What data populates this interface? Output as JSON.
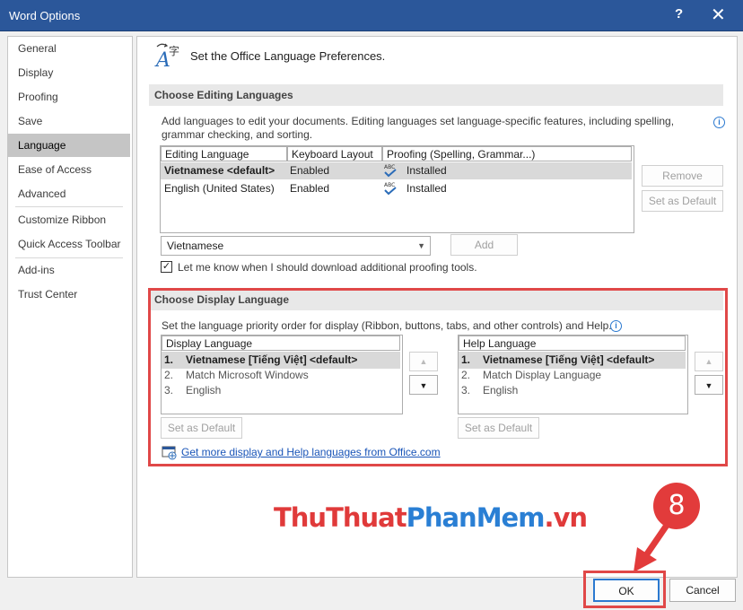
{
  "window": {
    "title": "Word Options",
    "help_glyph": "?",
    "close_glyph": "✕"
  },
  "nav": {
    "items": [
      "General",
      "Display",
      "Proofing",
      "Save",
      "Language",
      "Ease of Access",
      "Advanced",
      "Customize Ribbon",
      "Quick Access Toolbar",
      "Add-ins",
      "Trust Center"
    ],
    "selected": "Language"
  },
  "header": {
    "title": "Set the Office Language Preferences."
  },
  "editing": {
    "section_title": "Choose Editing Languages",
    "description": "Add languages to edit your documents. Editing languages set language-specific features, including spelling, grammar checking, and sorting.",
    "columns": [
      "Editing Language",
      "Keyboard Layout",
      "Proofing (Spelling, Grammar...)"
    ],
    "rows": [
      {
        "language": "Vietnamese <default>",
        "keyboard": "Enabled",
        "proofing": "Installed",
        "selected": true
      },
      {
        "language": "English (United States)",
        "keyboard": "Enabled",
        "proofing": "Installed",
        "selected": false
      }
    ],
    "remove_label": "Remove",
    "set_default_label": "Set as Default",
    "combo_value": "Vietnamese",
    "add_label": "Add",
    "checkbox_label": "Let me know when I should download additional proofing tools.",
    "checkbox_checked": true
  },
  "display": {
    "section_title": "Choose Display Language",
    "description": "Set the language priority order for display (Ribbon, buttons, tabs, and other controls) and Help.",
    "display_header": "Display Language",
    "display_items": [
      {
        "num": "1.",
        "label": "Vietnamese [Tiếng Việt] <default>",
        "selected": true
      },
      {
        "num": "2.",
        "label": "Match Microsoft Windows",
        "selected": false
      },
      {
        "num": "3.",
        "label": "English",
        "selected": false
      }
    ],
    "help_header": "Help Language",
    "help_items": [
      {
        "num": "1.",
        "label": "Vietnamese [Tiếng Việt] <default>",
        "selected": true
      },
      {
        "num": "2.",
        "label": "Match Display Language",
        "selected": false
      },
      {
        "num": "3.",
        "label": "English",
        "selected": false
      }
    ],
    "set_default_label": "Set as Default",
    "link_text": "Get more display and Help languages from Office.com"
  },
  "watermark": {
    "part1": "ThuThuat",
    "part2": "PhanMem",
    "part3": ".vn"
  },
  "step_badge": "8",
  "footer": {
    "ok_label": "OK",
    "cancel_label": "Cancel"
  },
  "colors": {
    "titlebar": "#2b579a",
    "highlight": "#e04848",
    "link": "#1a55b8"
  }
}
